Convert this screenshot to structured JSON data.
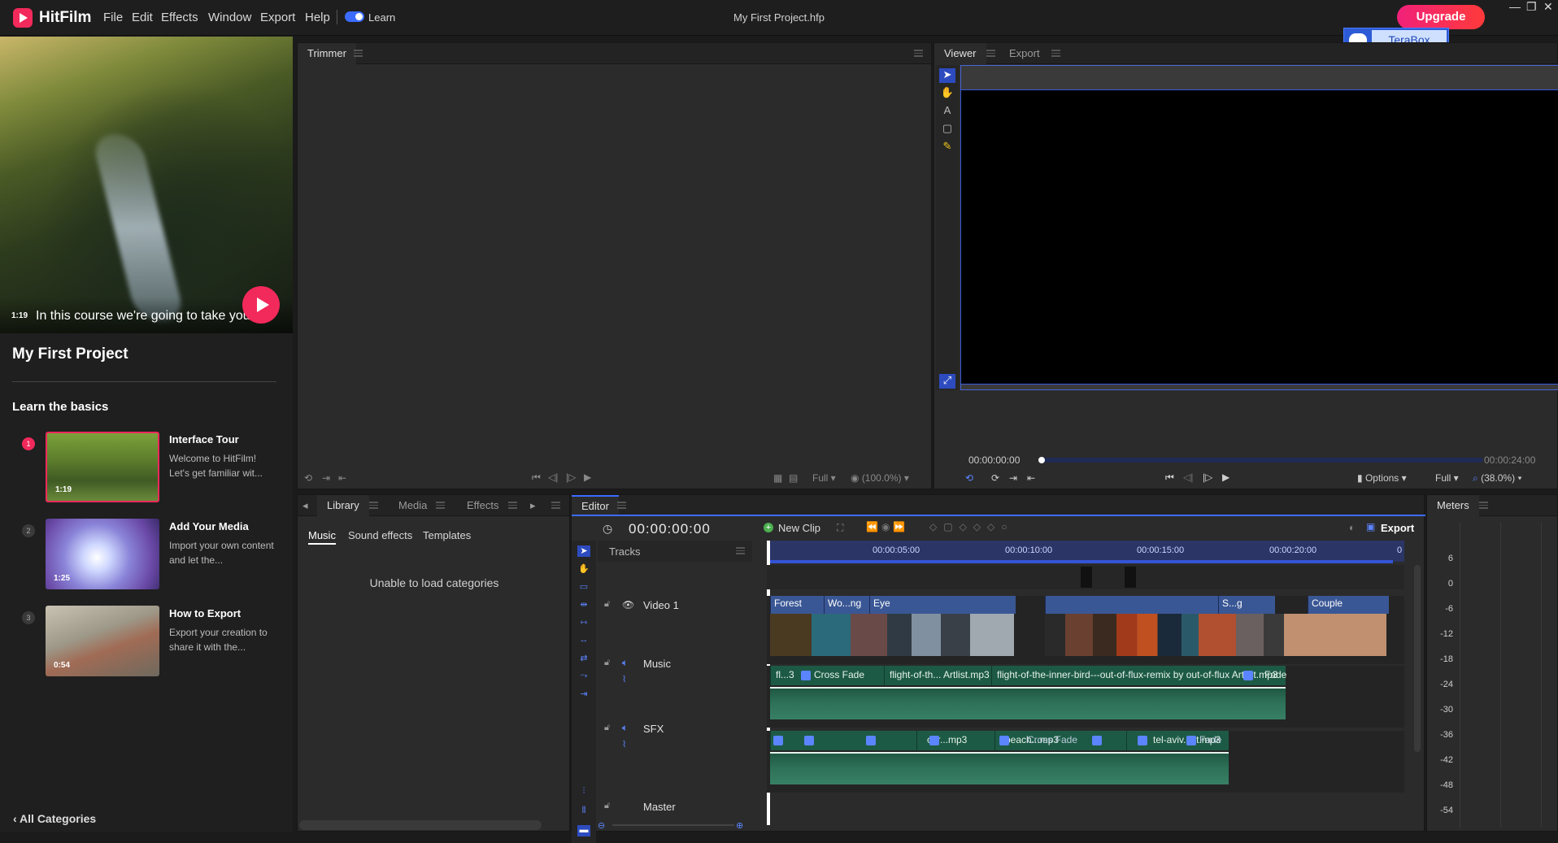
{
  "app": {
    "name": "HitFilm",
    "project_file": "My First Project.hfp",
    "menu": [
      "File",
      "Edit",
      "Effects",
      "Window",
      "Export",
      "Help"
    ],
    "learn_toggle_label": "Learn",
    "learn_toggle_on": true,
    "upgrade_label": "Upgrade",
    "window_controls": [
      "—",
      "❐",
      "✕"
    ],
    "terabox_label": "TeraBox",
    "accent_color": "#f2295b",
    "highlight_color": "#3b6cff"
  },
  "learn": {
    "hero": {
      "duration": "1:19",
      "caption": "In this course we're going to take you"
    },
    "project_title": "My First Project",
    "section_title": "Learn the basics",
    "courses": [
      {
        "num": "1",
        "title": "Interface Tour",
        "desc": "Welcome to HitFilm! Let's get familiar wit...",
        "duration": "1:19"
      },
      {
        "num": "2",
        "title": "Add Your Media",
        "desc": "Import your own content and let the...",
        "duration": "1:25"
      },
      {
        "num": "3",
        "title": "How to Export",
        "desc": "Export your creation to share it with the...",
        "duration": "0:54"
      }
    ],
    "all_categories": "All Categories"
  },
  "trimmer": {
    "tab": "Trimmer",
    "quality": "Full",
    "zoom": "(100.0%)"
  },
  "viewer": {
    "tabs": [
      "Viewer",
      "Export"
    ],
    "time_start": "00:00:00:00",
    "time_end": "00:00:24:00",
    "options_label": "Options",
    "quality": "Full",
    "zoom": "(38.0%)"
  },
  "library": {
    "tabs": [
      "Library",
      "Media",
      "Effects"
    ],
    "subtabs": [
      "Music",
      "Sound effects",
      "Templates"
    ],
    "message": "Unable to load categories"
  },
  "editor": {
    "tab": "Editor",
    "timecode": "00:00:00:00",
    "new_clip_label": "New Clip",
    "export_label": "Export",
    "tracks_label": "Tracks",
    "ruler_labels": [
      "00:00:05:00",
      "00:00:10:00",
      "00:00:15:00",
      "00:00:20:00",
      "0"
    ],
    "tracks": {
      "video1": "Video 1",
      "music": "Music",
      "sfx": "SFX",
      "master": "Master"
    },
    "video_clips": [
      "Forest",
      "Wo...ng",
      "Eye",
      "S...g",
      "Couple"
    ],
    "music_clips": [
      "fl...3",
      "Cross Fade",
      "flight-of-th... Artlist.mp3",
      "flight-of-the-inner-bird---out-of-flux-remix by out-of-flux Artlist.mp3",
      "Fade"
    ],
    "sfx_clips": [
      "car...mp3",
      "beach...mp3",
      "Cross Fade",
      "tel-aviv...st.mp3",
      "Fade"
    ]
  },
  "meters": {
    "tab": "Meters",
    "scale": [
      "6",
      "0",
      "-6",
      "-12",
      "-18",
      "-24",
      "-30",
      "-36",
      "-42",
      "-48",
      "-54"
    ]
  }
}
